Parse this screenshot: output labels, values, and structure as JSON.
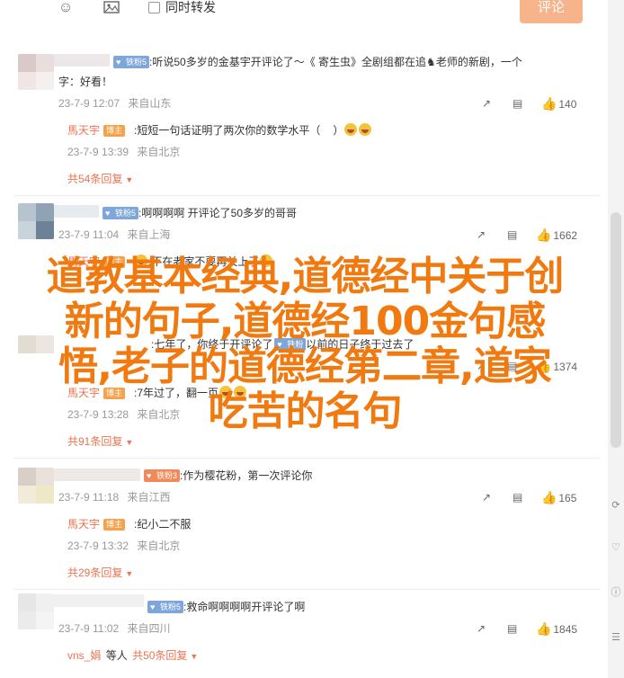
{
  "toolbar": {
    "emoji_icon": "smile-icon",
    "image_icon": "image-icon",
    "repost_label": "同时转发",
    "submit_label": "评论"
  },
  "overlay": {
    "lines": [
      "道教基本经典,道德经中关于创",
      "新的句子,道德经100金句感",
      "悟,老子的道德经第二章,道家",
      "吃苦的名句"
    ]
  },
  "comments": [
    {
      "badge": "铁粉5",
      "text": ":听说50多岁的金基宇开评论了～《 寄生虫》全剧组都在追",
      "text_tail": "老师的新剧，一个",
      "text_line2": "字：好看！",
      "time": "23-7-9 12:07",
      "location": "来自山东",
      "likes": "140",
      "reply": {
        "user": "馬天宇",
        "badge": "博主",
        "text": ":短短一句话证明了两次你的数学水平（",
        "text_tail": "）",
        "time": "23-7-9 13:39",
        "location": "来自北京"
      },
      "more": "共54条回复"
    },
    {
      "badge": "铁粉5",
      "text": ":啊啊啊啊 开评论了50多岁的哥哥",
      "time": "23-7-9 11:04",
      "location": "来自上海",
      "likes": "1662",
      "reply": {
        "user": "馬天宇",
        "badge": "博主",
        "text": ":不在老家不要再关上了",
        "time": "",
        "location": ""
      },
      "more": ""
    },
    {
      "badge": "铁粉",
      "text": ":七年了，你终于开评论了",
      "text_tail": "以前的日子终于过去了",
      "time": "",
      "location": "",
      "likes": "1374",
      "reply": {
        "user": "馬天宇",
        "badge": "博主",
        "text": ":7年过了，翻一页",
        "time": "23-7-9 13:28",
        "location": "来自北京"
      },
      "more": "共91条回复"
    },
    {
      "badge": "铁粉3",
      "text": ":作为樱花粉，第一次评论你",
      "time": "23-7-9 11:18",
      "location": "来自江西",
      "likes": "165",
      "reply": {
        "user": "馬天宇",
        "badge": "博主",
        "text": ":纪小二不服",
        "time": "23-7-9 13:32",
        "location": "来自北京"
      },
      "more": "共29条回复"
    },
    {
      "badge": "铁粉5",
      "text": ":救命啊啊啊啊开评论了啊",
      "time": "23-7-9 11:02",
      "location": "来自四川",
      "likes": "1845",
      "reply": {
        "user": "vns_娟",
        "badge": "",
        "text": "等人",
        "time": "",
        "location": ""
      },
      "more": "共50条回复"
    }
  ],
  "colors": {
    "accent": "#eb7350",
    "overlay_text": "#f07a10",
    "submit_bg": "#f7b38a",
    "badge_blue": "#7ea6d9"
  },
  "icons": {
    "share": "share-icon",
    "comment": "comment-icon",
    "like": "thumbs-up-icon"
  }
}
